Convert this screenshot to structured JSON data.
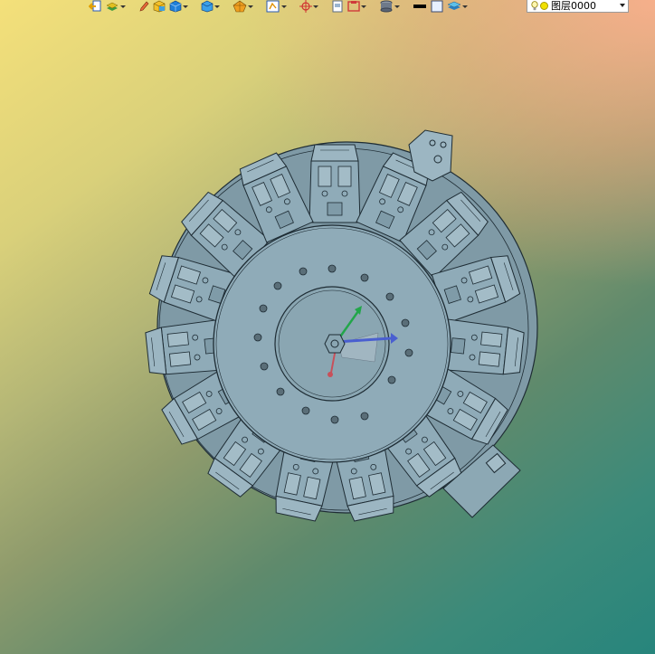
{
  "toolbar": {
    "icons": [
      "exit-icon",
      "layers-icon",
      "pencil-icon",
      "cube-yellow-icon",
      "cube-blue-icon",
      "cube-solid-icon",
      "render-mode-icon",
      "view-icon",
      "snap-icon",
      "page-icon",
      "frame-icon",
      "cylinder-icon",
      "color-black-icon",
      "color-white-icon",
      "layer-stack-icon"
    ],
    "layer_select": {
      "value": "图层0000"
    }
  },
  "colors": {
    "part_fill": "#8ca8b4",
    "part_stroke": "#1e2c34",
    "axis_x": "#4a5fd0",
    "axis_y": "#22a64a",
    "axis_z": "#c8505a"
  }
}
